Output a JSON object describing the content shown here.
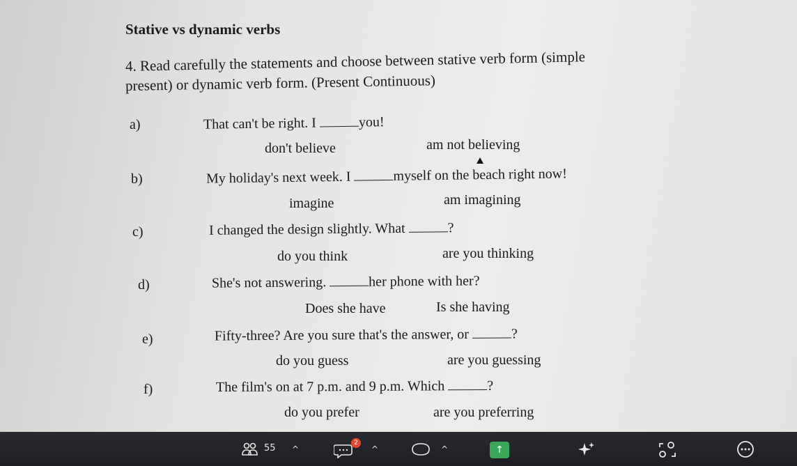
{
  "title": "Stative vs dynamic verbs",
  "instruction_line1": "4. Read carefully the statements and choose between stative verb form (simple",
  "instruction_line2": "present) or dynamic verb form. (Present Continuous)",
  "questions": [
    {
      "letter": "a)",
      "before": "That can't be right. I ",
      "after": "you!",
      "option1": "don't believe",
      "option2": "am not believing"
    },
    {
      "letter": "b)",
      "before": "My holiday's next week. I ",
      "after": "myself on the beach right now!",
      "option1": "imagine",
      "option2": "am imagining"
    },
    {
      "letter": "c)",
      "before": "I changed the design slightly. What ",
      "after": "?",
      "option1": "do you think",
      "option2": "are you thinking"
    },
    {
      "letter": "d)",
      "before": "She's not answering. ",
      "after": "her phone with her?",
      "option1": "Does she have",
      "option2": "Is she having"
    },
    {
      "letter": "e)",
      "before": "Fifty-three? Are you sure that's the answer, or ",
      "after": "?",
      "option1": "do you guess",
      "option2": "are you guessing"
    },
    {
      "letter": "f)",
      "before": "The film's on at 7 p.m. and 9 p.m. Which ",
      "after": "?",
      "option1": "do you prefer",
      "option2": "are you preferring"
    }
  ],
  "taskbar": {
    "participants_icon": "people-icon",
    "participants_count": "55",
    "chat_icon": "chat-icon",
    "chat_badge": "2",
    "reactions_icon": "heart-icon",
    "share_icon": "share-up-icon",
    "ai_icon": "sparkle-icon",
    "apps_icon": "apps-icon",
    "more_icon": "more-icon",
    "caret": "^"
  }
}
